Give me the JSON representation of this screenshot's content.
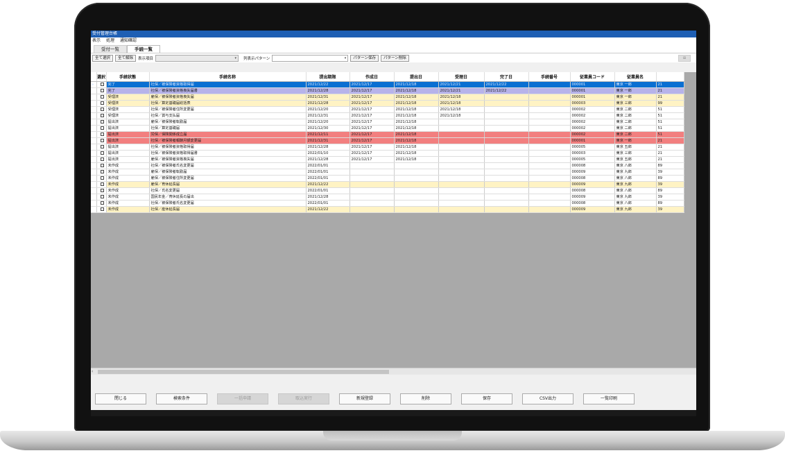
{
  "window": {
    "title": "受付管理台帳"
  },
  "menu": [
    "表示",
    "処理",
    "通知確認"
  ],
  "tabs": [
    {
      "label": "受付一覧"
    },
    {
      "label": "手続一覧"
    }
  ],
  "toolbar": {
    "select_all": "全て選択",
    "clear_all": "全て解除",
    "display_items_label": "表示項目",
    "display_items_value": "",
    "display_pattern_label": "列表示パターン",
    "display_pattern_value": "",
    "save_pattern": "パターン保存",
    "delete_pattern": "パターン削除",
    "right_button": "⊞"
  },
  "columns": [
    "選択",
    "手続状態",
    "手続名称",
    "提出期限",
    "作成日",
    "提出日",
    "受理日",
    "完了日",
    "手続番号",
    "従業員コード",
    "従業員名",
    ""
  ],
  "rows": [
    {
      "style": "blue",
      "marker": "▸",
      "status": "完了",
      "name": "社保／被保険者資格取得届",
      "deadline": "2021/12/22",
      "created": "2021/12/17",
      "submitted": "2021/12/18",
      "accepted": "2021/12/21",
      "completed": "2021/12/22",
      "no": "",
      "emp_code": "000001",
      "emp_name": "東京 一郎",
      "extra": "21"
    },
    {
      "style": "purple",
      "marker": "",
      "status": "完了",
      "name": "社保／被保険者資格喪失届書",
      "deadline": "2021/12/28",
      "created": "2021/12/17",
      "submitted": "2021/12/18",
      "accepted": "2021/12/21",
      "completed": "2021/12/22",
      "no": "",
      "emp_code": "000001",
      "emp_name": "東京 一郎",
      "extra": "21"
    },
    {
      "style": "yellow",
      "marker": "",
      "status": "受理済",
      "name": "雇保／被保険者資格喪失届",
      "deadline": "2021/12/31",
      "created": "2021/12/17",
      "submitted": "2021/12/18",
      "accepted": "2021/12/18",
      "completed": "",
      "no": "",
      "emp_code": "000001",
      "emp_name": "東京 一郎",
      "extra": "21"
    },
    {
      "style": "yellow",
      "marker": "",
      "status": "受理済",
      "name": "社保／算定基礎届総括表",
      "deadline": "2021/12/28",
      "created": "2021/12/17",
      "submitted": "2021/12/18",
      "accepted": "2021/12/18",
      "completed": "",
      "no": "",
      "emp_code": "000003",
      "emp_name": "東京 三郎",
      "extra": "99"
    },
    {
      "style": "white",
      "marker": "",
      "status": "受理済",
      "name": "社保／被保険者住所変更届",
      "deadline": "2021/12/20",
      "created": "2021/12/17",
      "submitted": "2021/12/18",
      "accepted": "2021/12/18",
      "completed": "",
      "no": "",
      "emp_code": "000002",
      "emp_name": "東京 二郎",
      "extra": "51"
    },
    {
      "style": "white",
      "marker": "",
      "status": "受理済",
      "name": "社保／賞与支払届",
      "deadline": "2021/12/31",
      "created": "2021/12/17",
      "submitted": "2021/12/18",
      "accepted": "2021/12/18",
      "completed": "",
      "no": "",
      "emp_code": "000002",
      "emp_name": "東京 二郎",
      "extra": "51"
    },
    {
      "style": "white",
      "marker": "",
      "status": "提出済",
      "name": "雇保／被保険者転勤届",
      "deadline": "2021/12/20",
      "created": "2021/12/17",
      "submitted": "2021/12/18",
      "accepted": "",
      "completed": "",
      "no": "",
      "emp_code": "000002",
      "emp_name": "東京 二郎",
      "extra": "51"
    },
    {
      "style": "white",
      "marker": "",
      "status": "提出済",
      "name": "社保／算定基礎届",
      "deadline": "2021/12/30",
      "created": "2021/12/17",
      "submitted": "2021/12/18",
      "accepted": "",
      "completed": "",
      "no": "",
      "emp_code": "000002",
      "emp_name": "東京 二郎",
      "extra": "51"
    },
    {
      "style": "red",
      "marker": "",
      "status": "提出済",
      "name": "労保／保険関係成立届",
      "deadline": "2021/12/11",
      "created": "2021/12/17",
      "submitted": "2021/12/18",
      "accepted": "",
      "completed": "",
      "no": "",
      "emp_code": "000002",
      "emp_name": "東京 二郎",
      "extra": "51"
    },
    {
      "style": "red",
      "marker": "",
      "status": "提出済",
      "name": "社保／被保険者報酬月額変更届",
      "deadline": "2021/12/31",
      "created": "2021/12/17",
      "submitted": "2021/12/18",
      "accepted": "",
      "completed": "",
      "no": "",
      "emp_code": "000001",
      "emp_name": "東京 一郎",
      "extra": "21"
    },
    {
      "style": "white",
      "marker": "",
      "status": "提出済",
      "name": "社保／被保険者資格取得届",
      "deadline": "2021/12/28",
      "created": "2021/12/17",
      "submitted": "2021/12/18",
      "accepted": "",
      "completed": "",
      "no": "",
      "emp_code": "000005",
      "emp_name": "東京 五郎",
      "extra": "21"
    },
    {
      "style": "white",
      "marker": "",
      "status": "提出済",
      "name": "社保／被保険者資格取得届書",
      "deadline": "2022/01/10",
      "created": "2021/12/17",
      "submitted": "2021/12/18",
      "accepted": "",
      "completed": "",
      "no": "",
      "emp_code": "000003",
      "emp_name": "東京 三郎",
      "extra": "21"
    },
    {
      "style": "white",
      "marker": "",
      "status": "提出済",
      "name": "雇保／被保険者資格喪失届",
      "deadline": "2021/12/28",
      "created": "2021/12/17",
      "submitted": "2021/12/18",
      "accepted": "",
      "completed": "",
      "no": "",
      "emp_code": "000005",
      "emp_name": "東京 五郎",
      "extra": "21"
    },
    {
      "style": "white",
      "marker": "",
      "status": "未作成",
      "name": "社保／被保険者氏名変更届",
      "deadline": "2022/01/01",
      "created": "",
      "submitted": "",
      "accepted": "",
      "completed": "",
      "no": "",
      "emp_code": "000008",
      "emp_name": "東京 八郎",
      "extra": "89"
    },
    {
      "style": "white",
      "marker": "",
      "status": "未作成",
      "name": "雇保／被保険者転勤届",
      "deadline": "2022/01/01",
      "created": "",
      "submitted": "",
      "accepted": "",
      "completed": "",
      "no": "",
      "emp_code": "000009",
      "emp_name": "東京 九郎",
      "extra": "39"
    },
    {
      "style": "white",
      "marker": "",
      "status": "未作成",
      "name": "雇保／被保険者住所変更届",
      "deadline": "2022/01/01",
      "created": "",
      "submitted": "",
      "accepted": "",
      "completed": "",
      "no": "",
      "emp_code": "000008",
      "emp_name": "東京 八郎",
      "extra": "89"
    },
    {
      "style": "yellow",
      "marker": "",
      "status": "未作成",
      "name": "雇保／育休延長届",
      "deadline": "2021/12/22",
      "created": "",
      "submitted": "",
      "accepted": "",
      "completed": "",
      "no": "",
      "emp_code": "000009",
      "emp_name": "東京 九郎",
      "extra": "39"
    },
    {
      "style": "white",
      "marker": "",
      "status": "未作成",
      "name": "社保／氏名変更届",
      "deadline": "2022/01/01",
      "created": "",
      "submitted": "",
      "accepted": "",
      "completed": "",
      "no": "",
      "emp_code": "000008",
      "emp_name": "東京 八郎",
      "extra": "89"
    },
    {
      "style": "white",
      "marker": "",
      "status": "未作成",
      "name": "国民年金／育休延長の届出",
      "deadline": "2021/12/28",
      "created": "",
      "submitted": "",
      "accepted": "",
      "completed": "",
      "no": "",
      "emp_code": "000009",
      "emp_name": "東京 九郎",
      "extra": "39"
    },
    {
      "style": "white",
      "marker": "",
      "status": "未作成",
      "name": "社保／被保険者氏名変更届",
      "deadline": "2022/01/01",
      "created": "",
      "submitted": "",
      "accepted": "",
      "completed": "",
      "no": "",
      "emp_code": "000008",
      "emp_name": "東京 八郎",
      "extra": "89"
    },
    {
      "style": "yellow",
      "marker": "",
      "status": "未作成",
      "name": "社保／産休延長届",
      "deadline": "2021/12/22",
      "created": "",
      "submitted": "",
      "accepted": "",
      "completed": "",
      "no": "",
      "emp_code": "000009",
      "emp_name": "東京 九郎",
      "extra": "39"
    }
  ],
  "buttons": [
    {
      "label": "閉じる",
      "disabled": false
    },
    {
      "label": "検索条件",
      "disabled": false
    },
    {
      "label": "一括申請",
      "disabled": true
    },
    {
      "label": "取込実行",
      "disabled": true
    },
    {
      "label": "新規登録",
      "disabled": false
    },
    {
      "label": "削除",
      "disabled": false
    },
    {
      "label": "保存",
      "disabled": false
    },
    {
      "label": "CSV出力",
      "disabled": false
    },
    {
      "label": "一覧印刷",
      "disabled": false
    }
  ]
}
